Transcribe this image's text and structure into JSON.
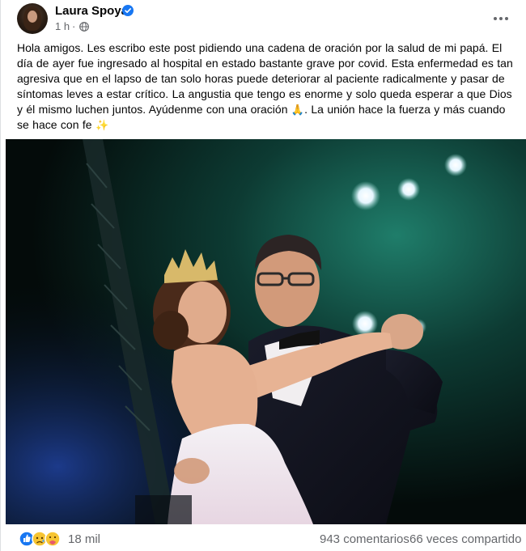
{
  "author": {
    "name": "Laura Spoya",
    "timestamp": "1 h",
    "separator": "·"
  },
  "post": {
    "text": "Hola amigos. Les escribo este post pidiendo una cadena de oración por la salud de mi papá. El día de ayer fue ingresado al hospital en estado bastante grave por covid. Esta enfermedad es tan agresiva que en el lapso de tan solo horas puede deteriorar al paciente radicalmente y pasar de síntomas leves a estar crítico. La angustia que tengo es enorme y solo queda esperar a que Dios y él mismo luchen juntos. Ayúdenme con una oración",
    "emoji_pray": "🙏",
    "text_2": ". La unión hace la fuerza y más cuando se hace con fe",
    "emoji_sparkles": "✨"
  },
  "engagement": {
    "reactions": "18 mil",
    "comments": "943 comentarios",
    "shares": "66 veces compartido",
    "reaction_icons": [
      "like-icon",
      "sad-icon",
      "care-icon"
    ]
  },
  "colors": {
    "verified": "#1877f2",
    "secondary_text": "#65676b",
    "primary_text": "#050505",
    "like": "#1877f2",
    "emoji_yellow": "#f7c533"
  },
  "photo": {
    "alt": ""
  }
}
